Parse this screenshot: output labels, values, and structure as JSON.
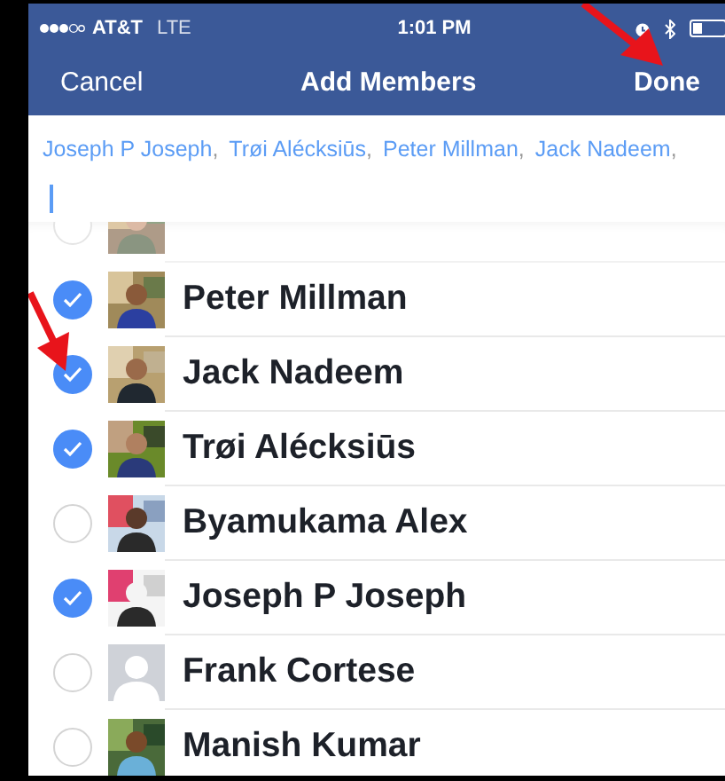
{
  "status_bar": {
    "carrier": "AT&T",
    "network": "LTE",
    "time": "1:01 PM"
  },
  "nav_bar": {
    "left_button": "Cancel",
    "title": "Add Members",
    "right_button": "Done"
  },
  "recipients": [
    {
      "name": "Joseph P Joseph"
    },
    {
      "name": "Trøi Alécksiūs"
    },
    {
      "name": "Peter Millman"
    },
    {
      "name": "Jack Nadeem"
    }
  ],
  "recipient_separator": ",",
  "contacts": [
    {
      "kind": "clipped",
      "selected": false
    },
    {
      "kind": "full",
      "name": "Peter Millman",
      "selected": true
    },
    {
      "kind": "full",
      "name": "Jack Nadeem",
      "selected": true
    },
    {
      "kind": "full",
      "name": "Trøi Alécksiūs",
      "selected": true
    },
    {
      "kind": "full",
      "name": "Byamukama Alex",
      "selected": false
    },
    {
      "kind": "full",
      "name": "Joseph P Joseph",
      "selected": true
    },
    {
      "kind": "full",
      "name": "Frank Cortese",
      "selected": false,
      "avatar": {
        "kind": "silhouette"
      }
    },
    {
      "kind": "full",
      "name": "Manish Kumar",
      "selected": false
    }
  ]
}
